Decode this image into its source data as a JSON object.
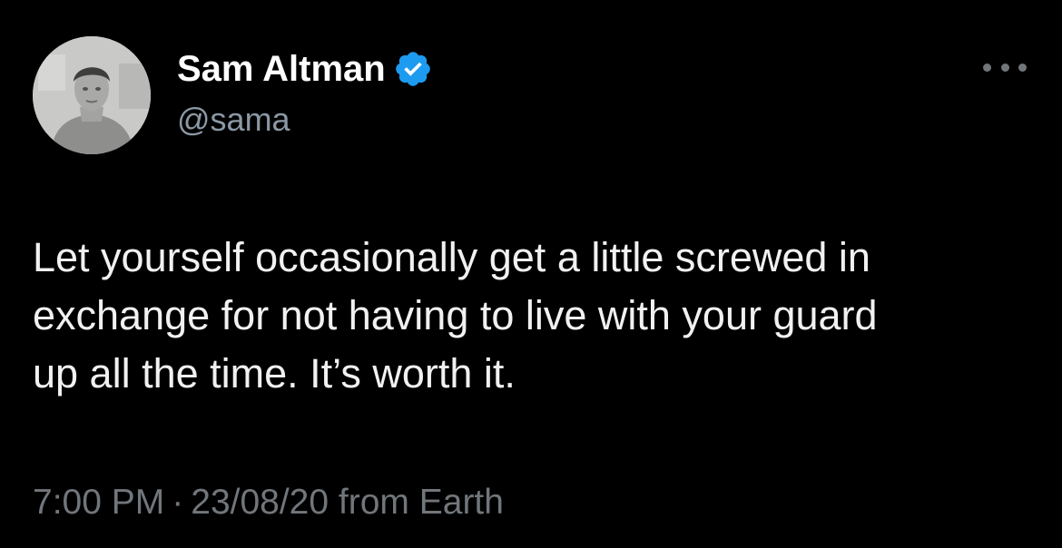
{
  "author": {
    "display_name": "Sam Altman",
    "handle": "@sama",
    "verified": true,
    "avatar_icon": "profile-photo",
    "verified_icon": "verified-badge-icon",
    "verified_color": "#1d9bf0"
  },
  "menu": {
    "icon": "more-options-icon"
  },
  "tweet": {
    "lines": [
      "Let yourself occasionally get a little screwed in",
      "exchange for not having to live with your guard",
      "up all the time. It’s worth it."
    ]
  },
  "meta": {
    "time": "7:00 PM",
    "separator": "·",
    "date": "23/08/20",
    "source": "from Earth"
  },
  "colors": {
    "background": "#000000",
    "primary_text": "#ffffff",
    "secondary_text": "#71767b",
    "accent": "#1d9bf0"
  }
}
